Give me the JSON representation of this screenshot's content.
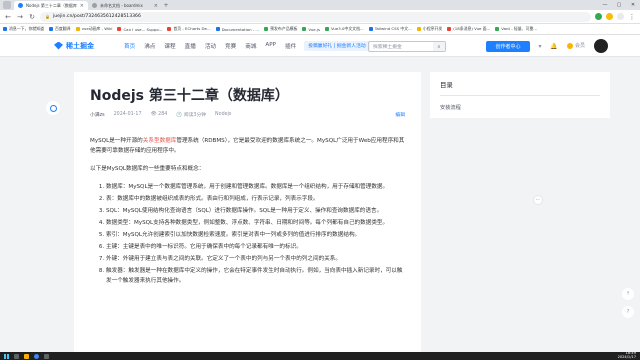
{
  "browser": {
    "tabs": [
      {
        "title": "Nodejs 第三十二章（数据库）",
        "active": true
      },
      {
        "title": "未命名文档 - boardmix",
        "active": false
      }
    ],
    "new_tab": "+",
    "window_controls": [
      "—",
      "▢",
      "✕"
    ],
    "url": "juejin.cn/post/7324635612428513366",
    "bookmarks": [
      "消息一下，你就知道",
      "百度翻译",
      "vue动画库 - Wiki",
      "Can I use... Suppo...",
      "首页 - ECharts De...",
      "Documentation - ...",
      "预发布产品模板",
      "Vue.js",
      "Vue3.0中文文档...",
      "Tailwind CSS 中文...",
      "小程序开发",
      "(18条消息) Vue 面...",
      "Vant - 轻量、可靠..."
    ]
  },
  "site": {
    "logo": "稀土掘金",
    "nav": [
      "首页",
      "沸点",
      "课程",
      "直播",
      "活动",
      "竞赛",
      "商城",
      "APP",
      "插件"
    ],
    "promo": "投稿赢好礼 | 掘金新人活动",
    "search_placeholder": "探索稀土掘金",
    "creator_button": "创作者中心",
    "member_label": "会员"
  },
  "article": {
    "title": "Nodejs 第三十二章（数据库）",
    "author": "小满zs",
    "date": "2024-01-17",
    "views": "284",
    "read_time": "阅读3分钟",
    "tag": "Nodejs",
    "edit": "编辑",
    "intro_before": "MySQL是一种开源的",
    "intro_highlight": "关系型数据库",
    "intro_after": "管理系统（RDBMS），它是最受欢迎的数据库系统之一。MySQL广泛用于Web应用程序和其他需要可靠数据存储的应用程序中。",
    "list_intro": "以下是MySQL数据库的一些重要特点和概念：",
    "items": [
      "数据库：MySQL是一个数据库管理系统，用于创建和管理数据库。数据库是一个组织结构，用于存储和管理数据。",
      "表：数据库中的数据被组织成表的形式。表由行和列组成，行表示记录，列表示字段。",
      "SQL：MySQL使用结构化查询语言（SQL）进行数据库操作。SQL是一种用于定义、操作和查询数据库的语言。",
      "数据类型：MySQL支持各种数据类型，例如整数、浮点数、字符串、日期和时间等。每个列都有自己的数据类型。",
      "索引：MySQL允许创建索引以加快数据检索速度。索引是对表中一列或多列的值进行排序的数据结构。",
      "主键：主键是表中的唯一标识符。它用于确保表中的每个记录都有唯一的标识。",
      "外键：外键用于建立表与表之间的关联。它定义了一个表中的列与另一个表中的列之间的关系。",
      "触发器：触发器是一种在数据库中定义的操作，它会在特定事件发生时自动执行。例如，当向表中插入新记录时，可以触发一个触发器来执行其他操作。"
    ]
  },
  "toc": {
    "title": "目录",
    "items": [
      "安装流程"
    ]
  },
  "taskbar": {
    "time": "18:49",
    "date": "2024/1/17"
  }
}
